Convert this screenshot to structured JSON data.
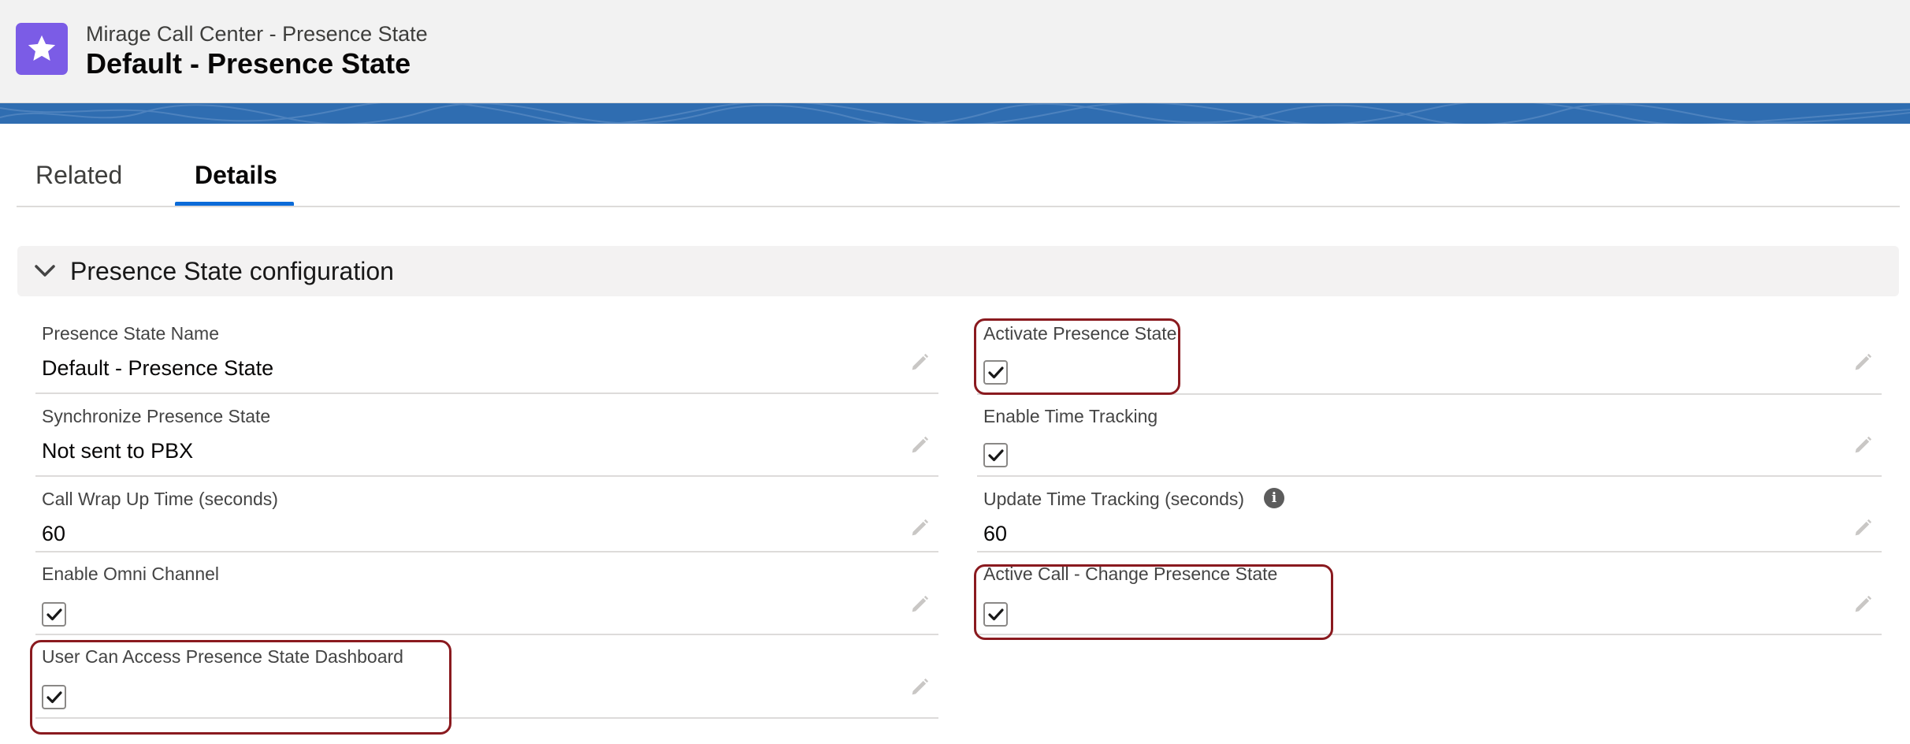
{
  "header": {
    "subtitle": "Mirage Call Center - Presence State",
    "title": "Default - Presence State",
    "icon": "star-icon",
    "icon_color": "#7b5ce6"
  },
  "tabs": [
    {
      "label": "Related",
      "active": false
    },
    {
      "label": "Details",
      "active": true
    }
  ],
  "section": {
    "title": "Presence State configuration",
    "expanded": true
  },
  "fields": {
    "presence_state_name": {
      "label": "Presence State Name",
      "value": "Default - Presence State"
    },
    "synchronize_presence_state": {
      "label": "Synchronize Presence State",
      "value": "Not sent to PBX"
    },
    "call_wrap_up_time": {
      "label": "Call Wrap Up Time (seconds)",
      "value": "60"
    },
    "enable_omni_channel": {
      "label": "Enable Omni Channel",
      "checked": true
    },
    "user_can_access_dashboard": {
      "label": "User Can Access Presence State Dashboard",
      "checked": true
    },
    "activate_presence_state": {
      "label": "Activate Presence State",
      "checked": true
    },
    "enable_time_tracking": {
      "label": "Enable Time Tracking",
      "checked": true
    },
    "update_time_tracking": {
      "label": "Update Time Tracking (seconds)",
      "value": "60",
      "info_icon": "info-icon"
    },
    "active_call_change_presence_state": {
      "label": "Active Call - Change Presence State",
      "checked": true
    }
  },
  "colors": {
    "accent": "#0b6bd8",
    "banner": "#2f6db1",
    "highlight": "#8a1a1f"
  }
}
